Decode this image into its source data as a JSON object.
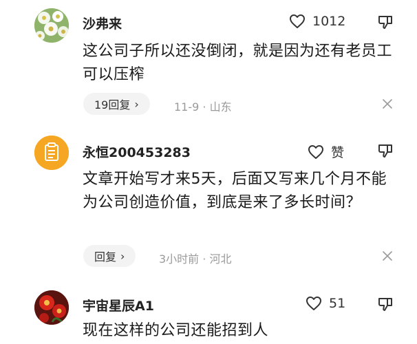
{
  "comments": [
    {
      "user": "沙弗来",
      "likes": "1012",
      "text": "这公司子所以还没倒闭，就是因为还有老员工可以压榨",
      "reply_label": "19回复",
      "chevron": "›",
      "meta": "11-9 · 山东",
      "avatar": "white-flowers-photo"
    },
    {
      "user": "永恒200453283",
      "likes": "赞",
      "text": "文章开始写才来5天，后面又写来几个月不能为公司创造价值，到底是来了多长时间？",
      "reply_label": "回复",
      "chevron": "›",
      "meta": "3小时前 · 河北",
      "avatar": "orange-document-avatar"
    },
    {
      "user": "宇宙星辰A1",
      "likes": "51",
      "text": "现在这样的公司还能招到人",
      "avatar": "red-flower-photo"
    }
  ],
  "colors": {
    "avatar_orange": "#f5a623",
    "pill_bg": "#f3f3f3",
    "meta_gray": "#9a9a9a"
  }
}
